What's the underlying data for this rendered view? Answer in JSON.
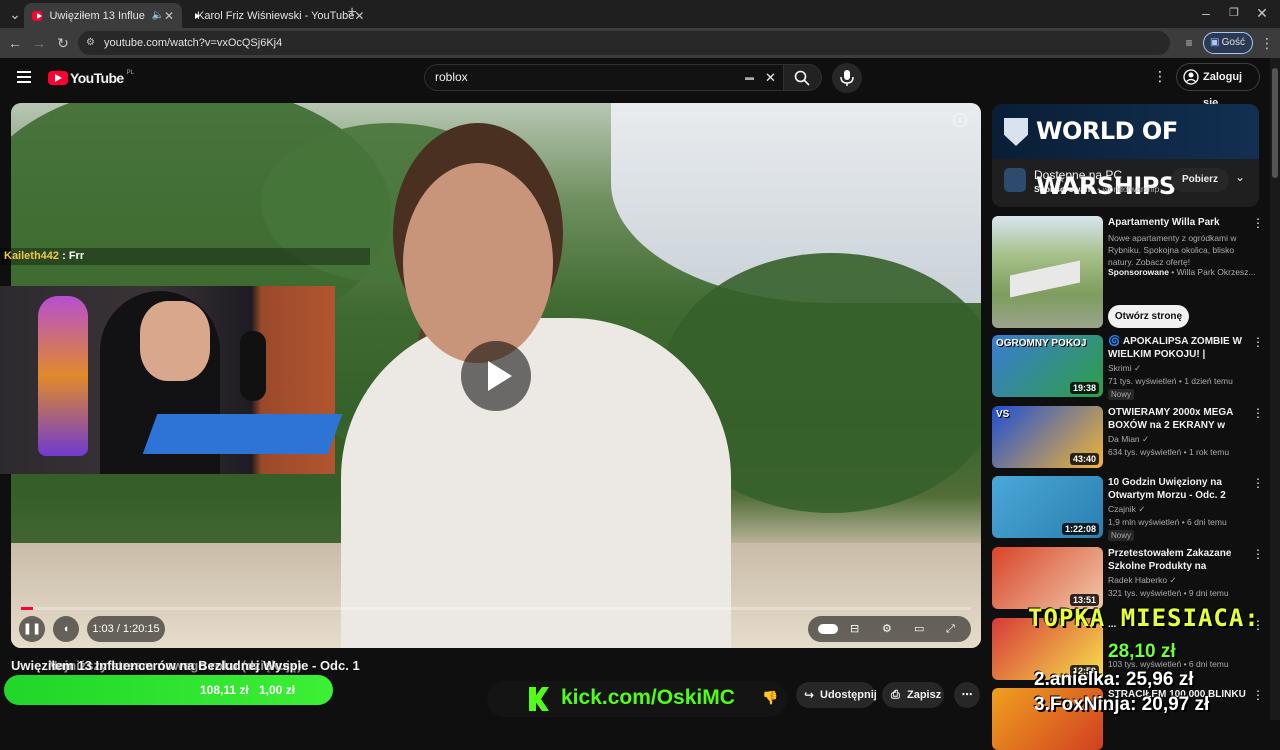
{
  "browser": {
    "tabs": [
      {
        "title": "Uwięziłem 13 Influencerów",
        "active": true
      },
      {
        "title": "Karol Friz Wiśniewski - YouTube",
        "active": false
      }
    ],
    "new_tab": "+",
    "url": "youtube.com/watch?v=vxOcQSj6Kj4",
    "profile_label": "Gość"
  },
  "youtube": {
    "logo": "YouTube",
    "region": "PL",
    "search_value": "roblox",
    "sign_in": "Zaloguj się"
  },
  "player": {
    "time": "1:03 / 1:20:15",
    "progress": 0.013,
    "chat_user": "Kaileth442",
    "chat_message": ": Frr"
  },
  "video": {
    "title": "Uwięziłem 13 Influencerów na Bezludnej Wyspie - Odc. 1",
    "overlay_text": "Najniższy stream nowego roku (dziękuję)",
    "share": "Udostępnij",
    "save": "Zapisz"
  },
  "stream_overlay": {
    "donation_values": [
      "108,11 zł",
      "1,00 zł"
    ],
    "kick_url": "kick.com/OskiMC",
    "topka_title": "TOPKA MIESIACA:",
    "top_amount_1": "28,10 zł",
    "top_2": "2.anielka: 25,96 zł",
    "top_3": "3.FoxNinja: 20,97 zł"
  },
  "ad": {
    "banner": "WORLD OF WARSHIPS",
    "title": "Dostępne na PC",
    "sponsored": "Sponsorowane",
    "domain": "worldofwarship...",
    "button": "Pobierz"
  },
  "ad2": {
    "title": "Apartamenty Willa Park Rybnik",
    "desc": "Nowe apartamenty z ogródkami w Rybniku. Spokojna okolica, blisko natury. Zobacz ofertę!",
    "sponsored": "Sponsorowane",
    "advertiser": "Willa Park Okrzesz...",
    "button": "Otwórz stronę"
  },
  "recommendations": [
    {
      "title": "🌀 APOKALIPSA ZOMBIE W WIELKIM POKOJU! | BeamNG ...",
      "channel": "Skrimi ✓",
      "meta": "71 tys. wyświetleń • 1 dzień temu",
      "badge": "Nowy",
      "duration": "19:38",
      "thumb_text": "OGROMNY POKOJ",
      "color1": "#3a7bd5",
      "color2": "#2ea043"
    },
    {
      "title": "OTWIERAMY 2000x MEGA BOXÓW na 2 EKRANY w BRAW...",
      "channel": "Da Mian ✓",
      "meta": "634 tys. wyświetleń • 1 rok temu",
      "badge": "",
      "duration": "43:40",
      "thumb_text": "VS",
      "color1": "#1f4fd6",
      "color2": "#f2b632"
    },
    {
      "title": "10 Godzin Uwięziony na Otwartym Morzu - Odc. 2",
      "channel": "Czajnik ✓",
      "meta": "1,9 mln wyświetleń • 6 dni temu",
      "badge": "Nowy",
      "duration": "1:22:08",
      "thumb_text": "",
      "color1": "#4aa8d8",
      "color2": "#2a7fb0"
    },
    {
      "title": "Przetestowałem Zakazane Szkolne Produkty na Egzaminie",
      "channel": "Radek Haberko ✓",
      "meta": "321 tys. wyświetleń • 9 dni temu",
      "badge": "",
      "duration": "13:51",
      "thumb_text": "",
      "color1": "#d9442a",
      "color2": "#f0c9a8"
    },
    {
      "title": "...",
      "channel": "",
      "meta": "103 tys. wyświetleń • 6 dni temu",
      "badge": "",
      "duration": "12:59",
      "thumb_text": "",
      "color1": "#d63a3a",
      "color2": "#f7e14a"
    },
    {
      "title": "STRACIŁEM 100.000 BLINKU ...",
      "channel": "",
      "meta": "",
      "badge": "",
      "duration": "",
      "thumb_text": "",
      "color1": "#f0a020",
      "color2": "#d04020"
    }
  ]
}
